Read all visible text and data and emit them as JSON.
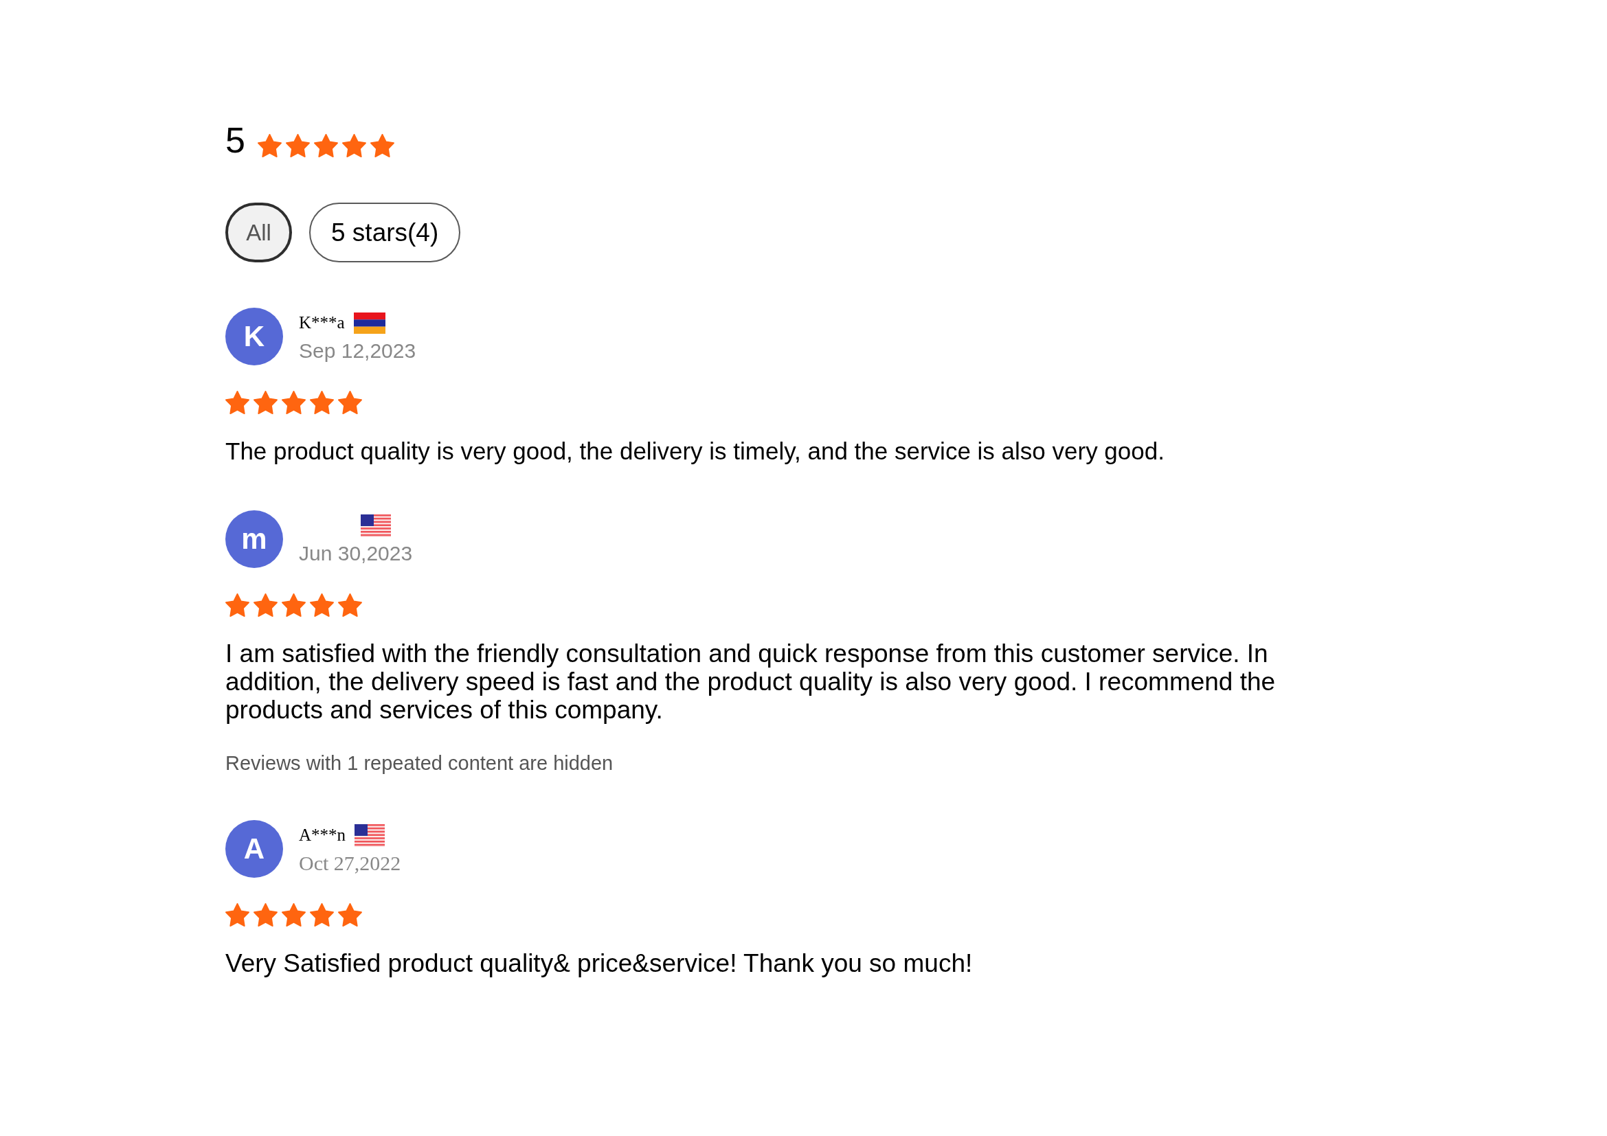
{
  "rating": {
    "score": "5",
    "stars": 5
  },
  "filters": [
    {
      "label": "All",
      "selected": true
    },
    {
      "label": "5 stars(4)",
      "selected": false
    }
  ],
  "reviews": [
    {
      "initial": "K",
      "name": "K***a",
      "flag": {
        "kind": "armenia"
      },
      "date": "Sep 12,2023",
      "stars": 5,
      "text": "The product quality is very good, the delivery is timely, and the service is also very good."
    },
    {
      "initial": "m",
      "flag": {
        "kind": "usa"
      },
      "date": "Jun 30,2023",
      "stars": 5,
      "text": "I am satisfied with the friendly consultation and quick response from this customer service. In addition, the delivery speed is fast and the product quality is also very good. I recommend the products and services of this company.",
      "notice": "Reviews with 1 repeated content are hidden"
    },
    {
      "initial": "A",
      "name": "A***n",
      "flag": {
        "kind": "usa"
      },
      "date": "Oct 27,2022",
      "stars": 5,
      "text": "Very Satisfied product quality& price&service! Thank you so much!"
    }
  ]
}
